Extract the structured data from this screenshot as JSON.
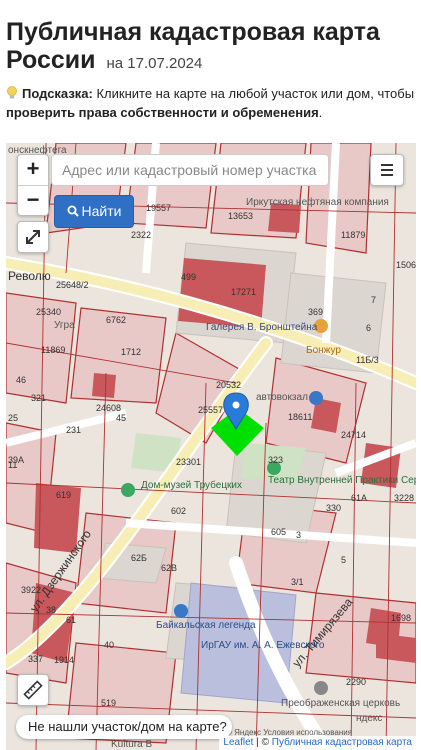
{
  "header": {
    "title": "Публичная кадастровая карта России",
    "date": "на 17.07.2024"
  },
  "hint": {
    "label": "Подсказка:",
    "text1": "Кликните на карте на любой участок или дом, чтобы",
    "bold": "проверить права собственности и обременения",
    "end": "."
  },
  "map": {
    "search_placeholder": "Адрес или кадастровый номер участка",
    "find_button": "Найти",
    "zoom_in": "+",
    "zoom_out": "−",
    "not_found": "Не нашли участок/дом на карте?",
    "attribution_leaflet": "Leaflet",
    "attribution_sep": " | © ",
    "attribution_source": "Публичная кадастровая карта",
    "labels": {
      "street_revolution": "Револю",
      "street_dzerzhinsky": "ул. Дзержинского",
      "street_timiryazeva": "ул. Тимирязева",
      "gallery": "Галерея В. Бронштейна",
      "bonjour": "Бонжур",
      "museum": "Дом-музей Трубецких",
      "theatre": "Театр Внутренней Практики Сергея",
      "baikal": "Байкальская легенда",
      "irgau": "ИрГАУ им. А. А. Ежевского",
      "church": "Преображенская церковь",
      "irkutsk_oil": "Иркутская нефтяная компания",
      "avtovok": "автовокзал",
      "ugra": "Угра",
      "kultura": "Kultura B",
      "yandex": "ндекс",
      "yandex_terms": "© Яндекс Условия использования",
      "oil_top": "онскнефтега"
    },
    "parcel_numbers": [
      "19557",
      "13653",
      "11879",
      "499",
      "17271",
      "369",
      "25648/2",
      "25340",
      "11869",
      "1712",
      "24608",
      "45",
      "20532",
      "25557",
      "18611",
      "24714",
      "23301",
      "323",
      "602",
      "605",
      "330",
      "61А",
      "62Б",
      "62В",
      "3922",
      "337",
      "519",
      "1698",
      "2290",
      "3228",
      "25",
      "11",
      "46",
      "321",
      "231",
      "619",
      "6762",
      "1506",
      "2322",
      "7",
      "6",
      "11Б/3",
      "3/1",
      "5",
      "3",
      "38",
      "61",
      "39А",
      "1914",
      "40"
    ]
  },
  "colors": {
    "accent_button": "#2f6fc4",
    "selected_parcel": "#00e000",
    "building_red": "#c9585c",
    "parcel_border": "#b03030",
    "pin_blue": "#2a7ad8"
  }
}
